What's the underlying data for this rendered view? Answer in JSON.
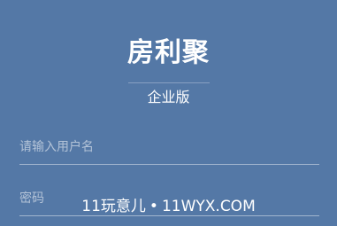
{
  "brand": {
    "logo_text": "房利聚",
    "edition": "企业版"
  },
  "form": {
    "username": {
      "value": "",
      "placeholder": "请输入用户名"
    },
    "password": {
      "value": "",
      "placeholder": "密码"
    }
  },
  "watermark": {
    "left": "11玩意儿",
    "separator": "•",
    "right": "11WYX.COM"
  },
  "colors": {
    "background": "#5478a6",
    "text": "#ffffff"
  }
}
